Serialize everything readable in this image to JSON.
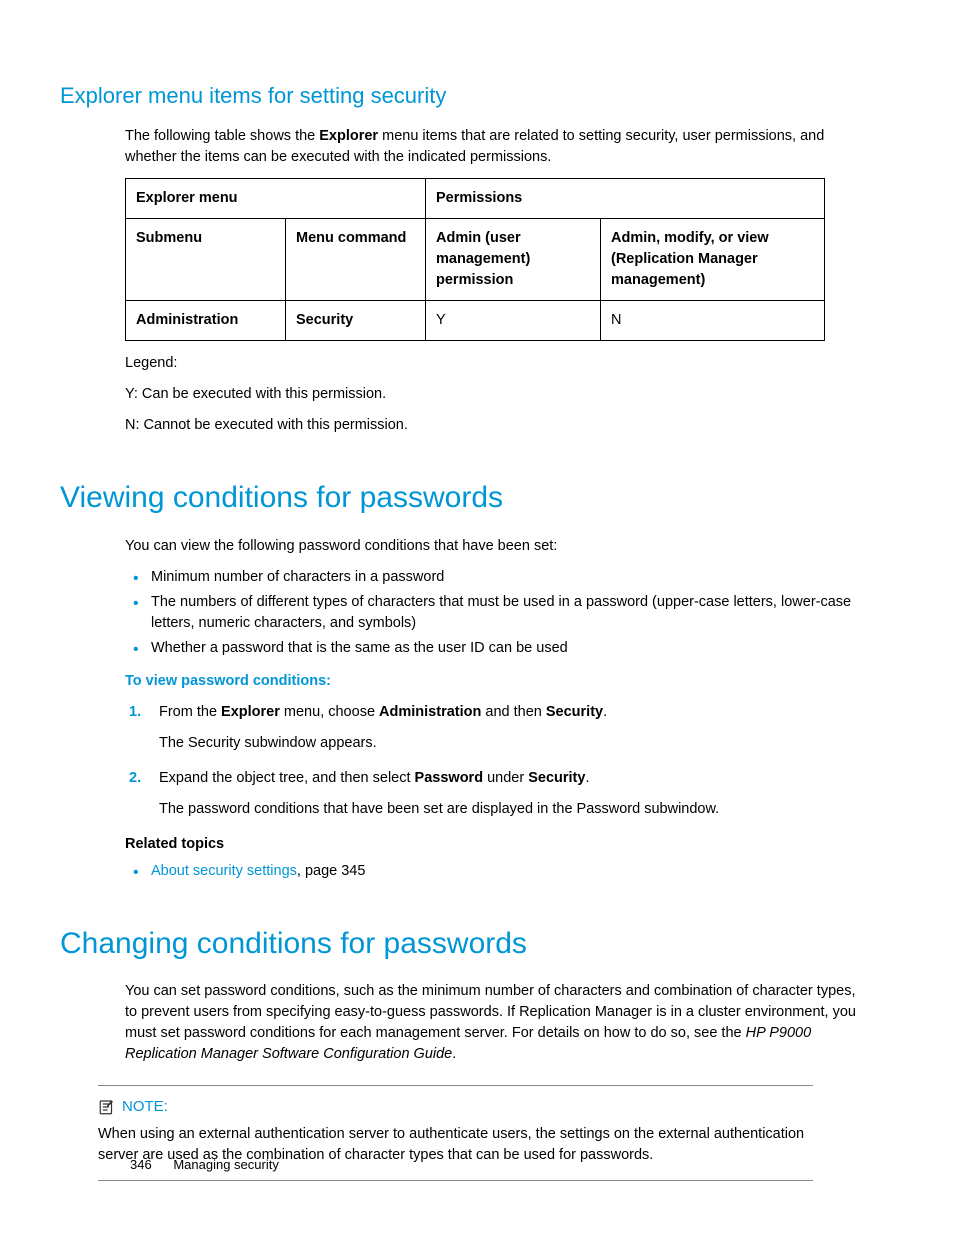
{
  "section1": {
    "heading": "Explorer menu items for setting security",
    "intro_parts": [
      "The following table shows the ",
      "Explorer",
      " menu items that are related to setting security, user permissions, and whether the items can be executed with the indicated permissions."
    ],
    "table": {
      "headers": {
        "r1c1": "Explorer menu",
        "r1c2": "Permissions",
        "r2c1": "Submenu",
        "r2c2": "Menu command",
        "r2c3": "Admin (user management) permission",
        "r2c4": "Admin, modify, or view (Replication Manager management)"
      },
      "rows": [
        {
          "submenu": "Administration",
          "command": "Security",
          "admin": "Y",
          "view": "N"
        }
      ]
    },
    "legend_label": "Legend:",
    "legend_y": "Y: Can be executed with this permission.",
    "legend_n": "N: Cannot be executed with this permission."
  },
  "section2": {
    "heading": "Viewing conditions for passwords",
    "intro": "You can view the following password conditions that have been set:",
    "bullets": [
      "Minimum number of characters in a password",
      "The numbers of different types of characters that must be used in a password (upper-case letters, lower-case letters, numeric characters, and symbols)",
      "Whether a password that is the same as the user ID can be used"
    ],
    "procedure_heading": "To view password conditions:",
    "steps": [
      {
        "parts": [
          "From the ",
          "Explorer",
          " menu, choose ",
          "Administration",
          " and then ",
          "Security",
          "."
        ],
        "result": "The Security subwindow appears."
      },
      {
        "parts": [
          "Expand the object tree, and then select ",
          "Password",
          " under ",
          "Security",
          "."
        ],
        "result": "The password conditions that have been set are displayed in the Password subwindow."
      }
    ],
    "related_heading": "Related topics",
    "related_link_text": "About security settings",
    "related_suffix": ", page 345"
  },
  "section3": {
    "heading": "Changing conditions for passwords",
    "intro_parts": [
      "You can set password conditions, such as the minimum number of characters and combination of character types, to prevent users from specifying easy-to-guess passwords. If Replication Manager is in a cluster environment, you must set password conditions for each management server. For details on how to do so, see the ",
      "HP P9000 Replication Manager Software Configuration Guide",
      "."
    ],
    "note_label": "NOTE:",
    "note_body": "When using an external authentication server to authenticate users, the settings on the external authentication server are used as the combination of character types that can be used for passwords."
  },
  "footer": {
    "page": "346",
    "title": "Managing security"
  }
}
